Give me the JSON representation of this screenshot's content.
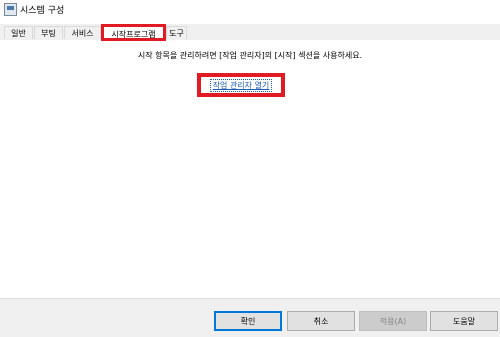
{
  "window": {
    "title": "시스템 구성",
    "icon": "system-config-icon"
  },
  "tabs": [
    {
      "label": "일반",
      "active": false
    },
    {
      "label": "부팅",
      "active": false
    },
    {
      "label": "서비스",
      "active": false
    },
    {
      "label": "시작프로그램",
      "active": true
    },
    {
      "label": "도구",
      "active": false
    }
  ],
  "startup": {
    "message": "시작 항목을 관리하려면 [작업 관리자]의 [시작] 섹션을 사용하세요.",
    "link": "작업 관리자 열기"
  },
  "buttons": {
    "ok": "확인",
    "cancel": "취소",
    "apply": "적용(A)",
    "help": "도움말"
  },
  "colors": {
    "highlight": "#e01b24",
    "link": "#1a5fb4"
  }
}
